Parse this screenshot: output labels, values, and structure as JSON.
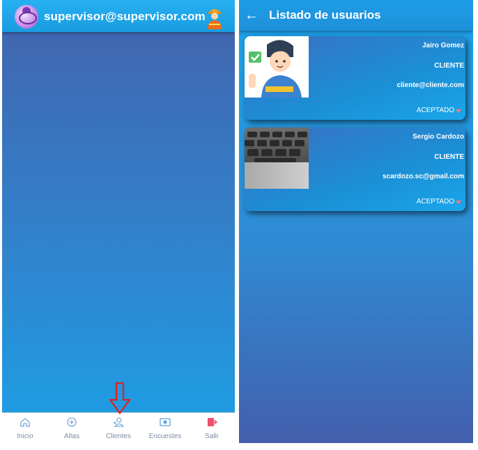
{
  "left_screen": {
    "header": {
      "email": "supervisor@supervisor.com"
    },
    "bottom_nav": [
      {
        "label": "Inicio",
        "icon": "home-icon"
      },
      {
        "label": "Altas",
        "icon": "plus-circle-icon"
      },
      {
        "label": "Clientes",
        "icon": "user-add-icon"
      },
      {
        "label": "Encuestes",
        "icon": "survey-icon"
      },
      {
        "label": "Salir",
        "icon": "logout-icon"
      }
    ]
  },
  "right_screen": {
    "header": {
      "title": "Listado de usuarios",
      "back_icon": "arrow-left-icon"
    },
    "users": [
      {
        "name": "Jairo Gomez",
        "role": "CLIENTE",
        "email": "cliente@cliente.com",
        "status": "ACEPTADO"
      },
      {
        "name": "Sergio Cardozo",
        "role": "CLIENTE",
        "email": "scardozo.sc@gmail.com",
        "status": "ACEPTADO"
      }
    ]
  },
  "colors": {
    "accent": "#1a9ce0",
    "caret": "#ff7a7a",
    "arrow": "#e02020"
  }
}
